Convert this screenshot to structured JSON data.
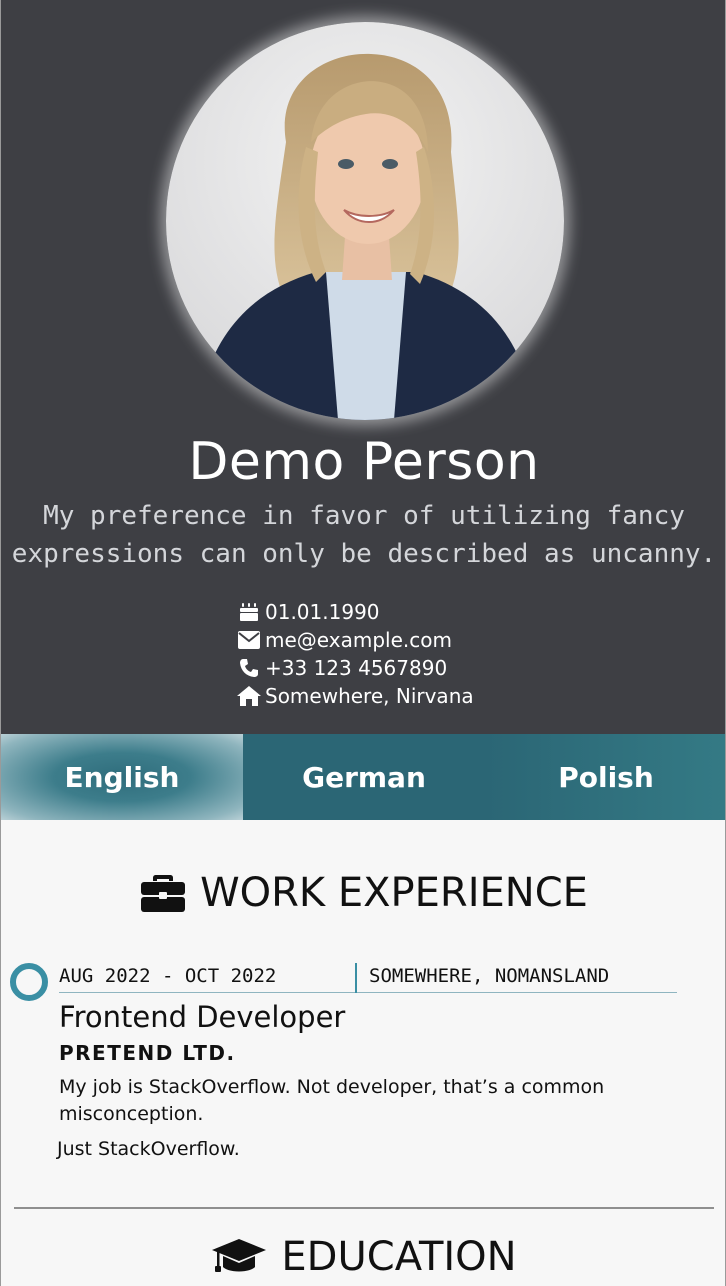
{
  "profile": {
    "name": "Demo Person",
    "tagline_line1": "My preference in favor of utilizing fancy",
    "tagline_line2": "expressions can only be described as uncanny."
  },
  "contacts": {
    "birthday": {
      "icon": "birthday-cake-icon",
      "text": "01.01.1990"
    },
    "email": {
      "icon": "envelope-icon",
      "text": "me@example.com"
    },
    "phone": {
      "icon": "phone-icon",
      "text": "+33 123 4567890"
    },
    "address": {
      "icon": "home-icon",
      "text": "Somewhere, Nirvana"
    }
  },
  "languages": {
    "tabs": [
      {
        "label": "English",
        "active": true
      },
      {
        "label": "German",
        "active": false
      },
      {
        "label": "Polish",
        "active": false
      }
    ]
  },
  "sections": {
    "work": {
      "icon": "briefcase-icon",
      "title": "WORK EXPERIENCE",
      "entries": [
        {
          "dates": "AUG 2022 - OCT 2022",
          "location": "SOMEWHERE, NOMANSLAND",
          "role": "Frontend Developer",
          "company": "PRETEND LTD.",
          "description": "My job is StackOverflow. Not developer, that’s a common misconception.",
          "description2": "Just StackOverflow."
        }
      ]
    },
    "education": {
      "icon": "graduation-cap-icon",
      "title": "EDUCATION"
    }
  },
  "colors": {
    "header_bg": "#3e3f44",
    "accent": "#3a8fa4",
    "tab_bg": "#2b6675",
    "page_bg": "#f7f7f7"
  }
}
